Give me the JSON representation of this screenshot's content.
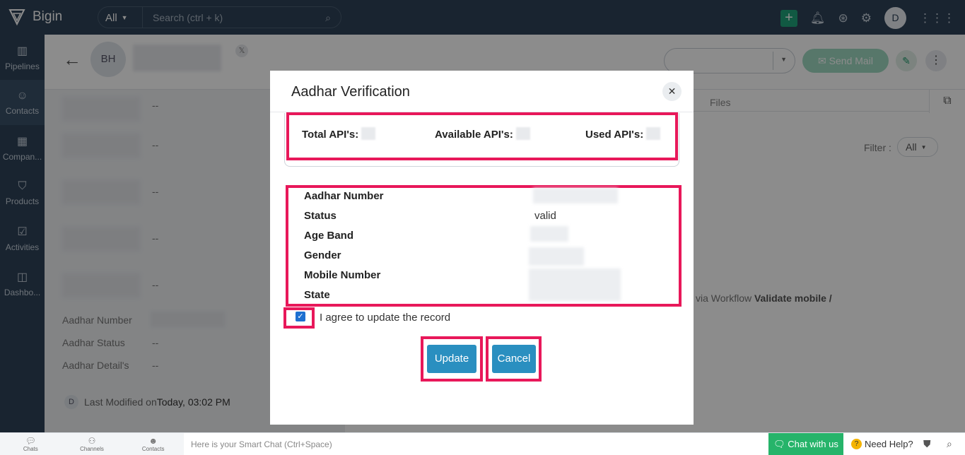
{
  "app": {
    "name": "Bigin"
  },
  "topbar": {
    "filter_value": "All",
    "search_placeholder": "Search (ctrl + k)",
    "avatar_initial": "D"
  },
  "sidebar": {
    "items": [
      {
        "label": "Pipelines",
        "icon": "pipelines-icon"
      },
      {
        "label": "Contacts",
        "icon": "contacts-icon",
        "active": true
      },
      {
        "label": "Compan...",
        "icon": "companies-icon"
      },
      {
        "label": "Products",
        "icon": "products-icon"
      },
      {
        "label": "Activities",
        "icon": "activities-icon"
      },
      {
        "label": "Dashbo...",
        "icon": "dashboards-icon"
      }
    ]
  },
  "record": {
    "avatar_initials": "BH",
    "send_mail_label": "Send Mail",
    "files_tab": "Files",
    "filter_label": "Filter :",
    "filter_value": "All",
    "fields": [
      {
        "label": "Aadhar Number",
        "value": ""
      },
      {
        "label": "Aadhar Status",
        "value": "--"
      },
      {
        "label": "Aadhar Detail's",
        "value": "--"
      }
    ],
    "placeholder_values": [
      "--",
      "--",
      "--",
      "--",
      "--"
    ],
    "last_modified_prefix": "Last Modified on",
    "last_modified_value": "Today, 03:02 PM",
    "last_modified_initial": "D",
    "workflow_text": "via Workflow",
    "workflow_bold": "Validate mobile /"
  },
  "modal": {
    "title": "Aadhar Verification",
    "api": {
      "total_label": "Total API's:",
      "available_label": "Available API's:",
      "used_label": "Used API's:"
    },
    "details": [
      {
        "label": "Aadhar Number",
        "value": ""
      },
      {
        "label": "Status",
        "value": "valid"
      },
      {
        "label": "Age Band",
        "value": ""
      },
      {
        "label": "Gender",
        "value": ""
      },
      {
        "label": "Mobile Number",
        "value": ""
      },
      {
        "label": "State",
        "value": ""
      }
    ],
    "agree_label": "I agree to update the record",
    "agree_checked": true,
    "update_label": "Update",
    "cancel_label": "Cancel"
  },
  "bottombar": {
    "items": [
      "Chats",
      "Channels",
      "Contacts"
    ],
    "smart_chat_placeholder": "Here is your Smart Chat (Ctrl+Space)",
    "chat_with_us": "Chat with us",
    "need_help": "Need Help?"
  },
  "colors": {
    "nav_bg": "#2f4358",
    "highlight": "#e8185a",
    "button": "#2a8fc0",
    "chat_green": "#26b46a"
  }
}
